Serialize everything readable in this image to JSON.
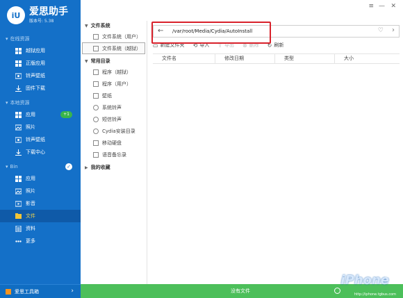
{
  "app": {
    "name": "爱思助手",
    "version": "版本号: 5.38",
    "logo_text": "iU"
  },
  "sidebar": {
    "sections": [
      {
        "title": "在线资源",
        "items": [
          {
            "label": "越狱应用",
            "icon": "apps-icon"
          },
          {
            "label": "正版应用",
            "icon": "apps-icon"
          },
          {
            "label": "铃声壁纸",
            "icon": "ringtone-icon"
          },
          {
            "label": "固件下载",
            "icon": "download-icon"
          }
        ]
      },
      {
        "title": "本地资源",
        "items": [
          {
            "label": "应用",
            "icon": "apps-icon",
            "badge": "+1"
          },
          {
            "label": "照片",
            "icon": "photo-icon"
          },
          {
            "label": "铃声壁纸",
            "icon": "ringtone-icon"
          },
          {
            "label": "下载中心",
            "icon": "download-icon"
          }
        ]
      },
      {
        "title": "Bin",
        "items": [
          {
            "label": "应用",
            "icon": "apps-icon"
          },
          {
            "label": "照片",
            "icon": "photo-icon"
          },
          {
            "label": "影音",
            "icon": "video-icon"
          },
          {
            "label": "文件",
            "icon": "file-icon",
            "active": true
          },
          {
            "label": "资料",
            "icon": "data-icon"
          },
          {
            "label": "更多",
            "icon": "more-icon"
          }
        ]
      }
    ],
    "footer": "爱思工具箱"
  },
  "tree": {
    "file_system_head": "文件系统",
    "file_system_items": [
      "文件系统（用户）",
      "文件系统（越狱）"
    ],
    "common_head": "常用目录",
    "common_items": [
      "程序（越狱）",
      "程序（用户）",
      "壁纸",
      "系统铃声",
      "短信铃声",
      "Cydia安装目录",
      "移动硬盘",
      "语音备忘录"
    ],
    "favorites_head": "我的收藏"
  },
  "address": {
    "path": "/var/root/Media/Cydia/AutoInstall"
  },
  "toolbar": {
    "new_folder": "新建文件夹",
    "import": "导入",
    "export": "导出",
    "delete": "删除",
    "refresh": "刷新"
  },
  "table": {
    "columns": [
      "文件名",
      "修改日期",
      "类型",
      "大小"
    ]
  },
  "status": {
    "message": "没有文件"
  },
  "watermark": {
    "brand": "iPhone",
    "suffix": "中文网",
    "url": "http://iphone.tgbus.com"
  },
  "colors": {
    "sidebar": "#1470c8",
    "status": "#4cbf5a",
    "highlight": "#d8202a"
  }
}
